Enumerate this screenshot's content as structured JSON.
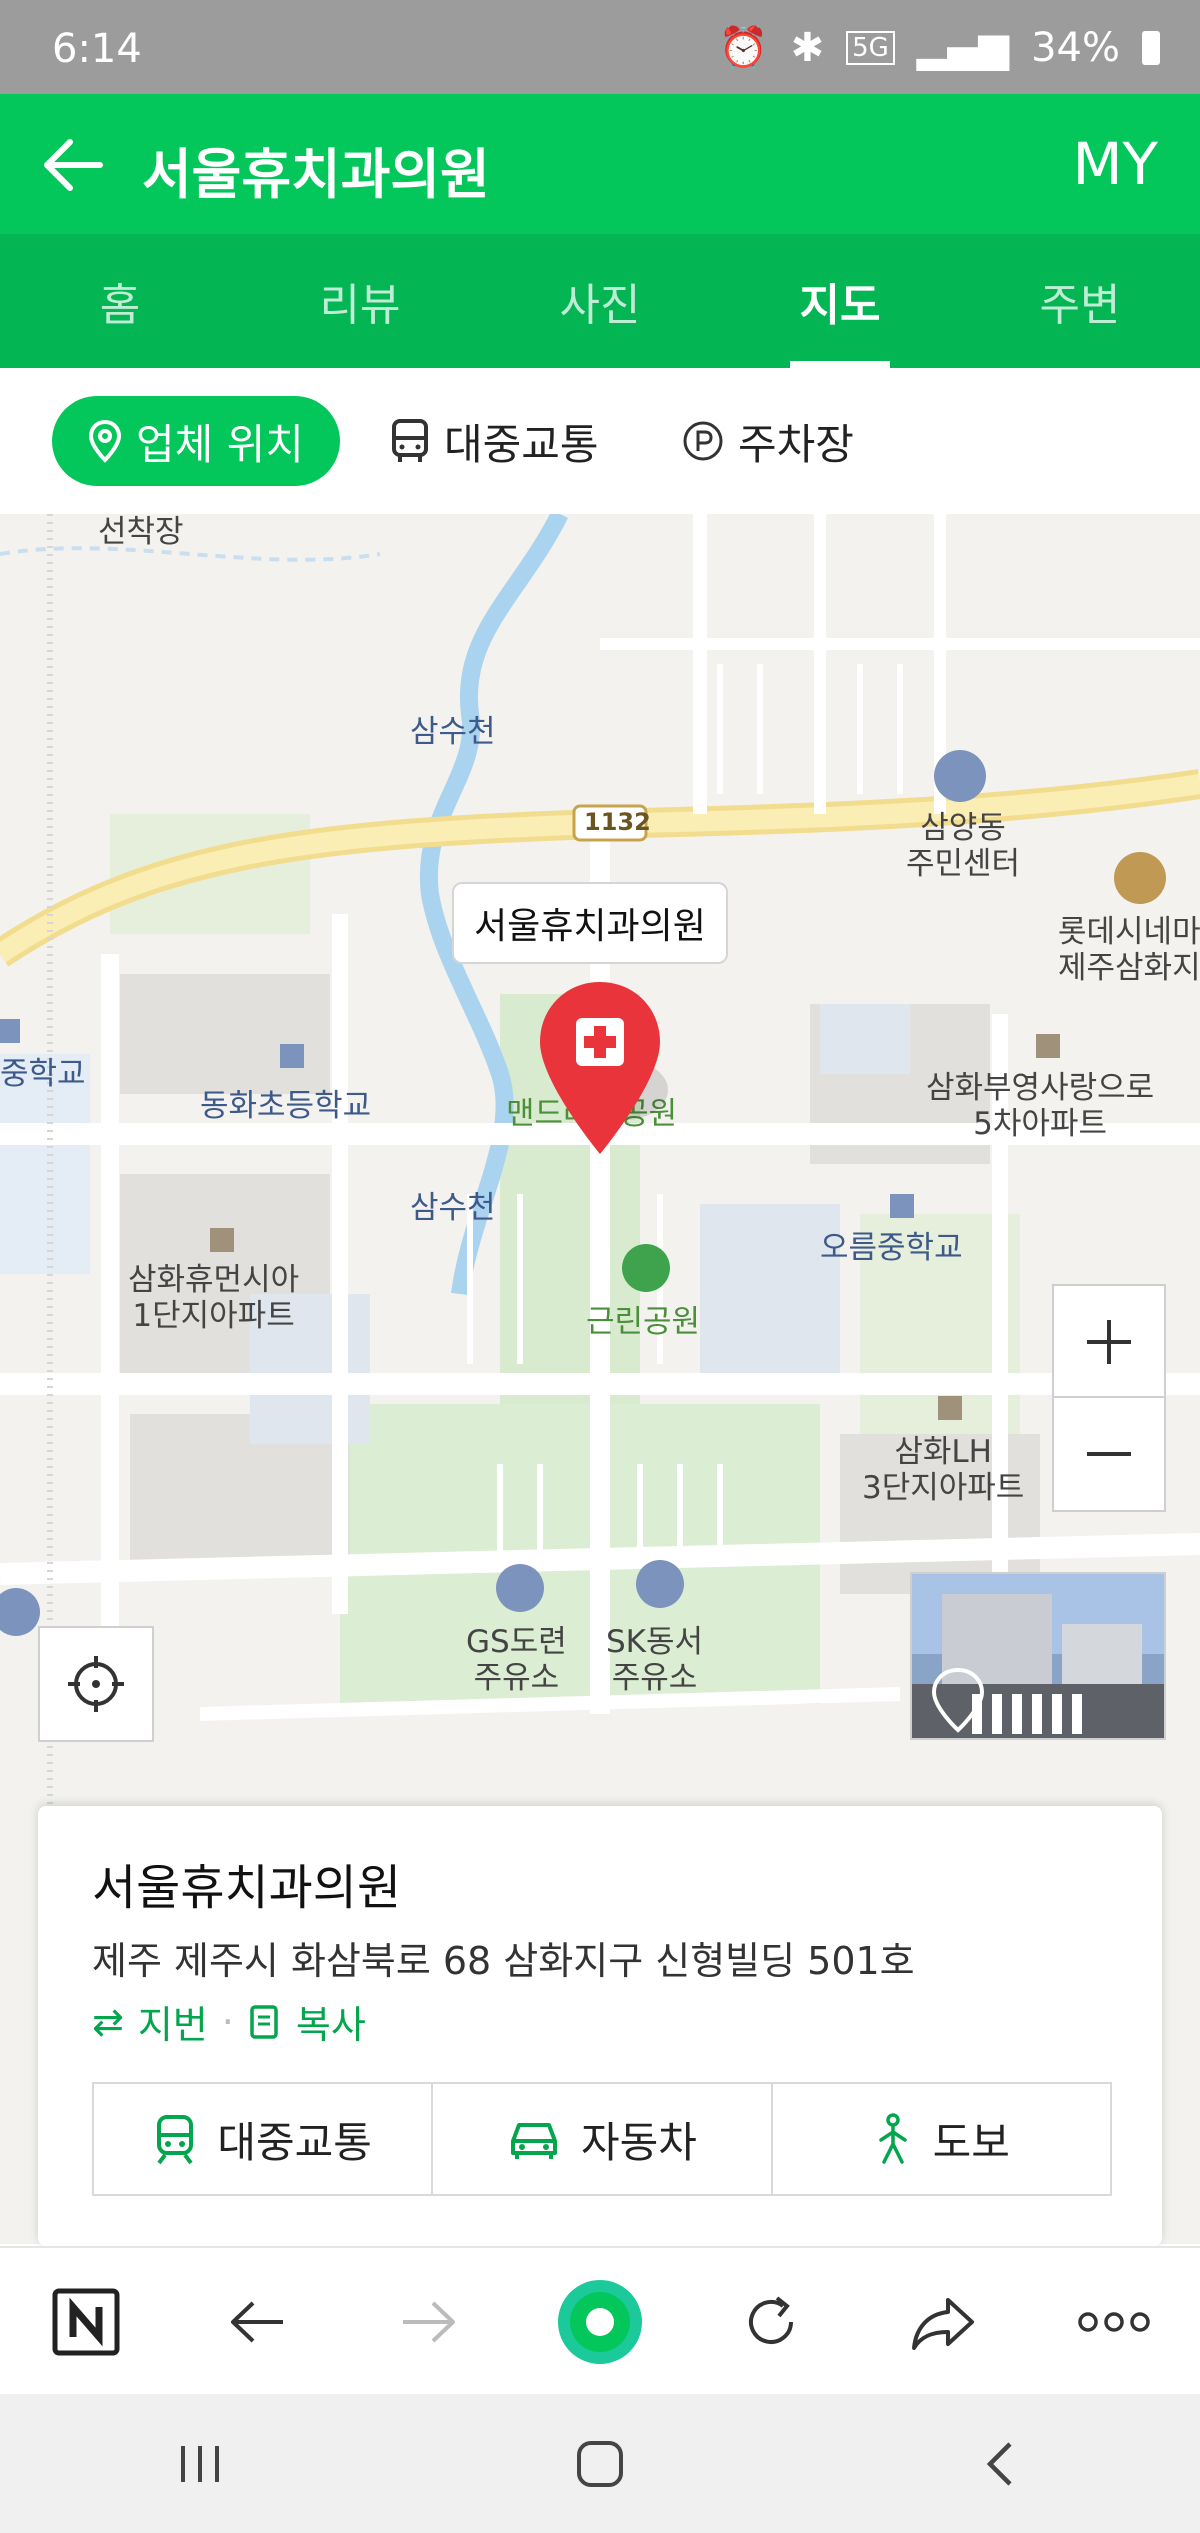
{
  "status_bar": {
    "time": "6:14",
    "network": "5G",
    "battery": "34%"
  },
  "header": {
    "title": "서울휴치과의원",
    "my_label": "MY"
  },
  "tabs": [
    {
      "label": "홈",
      "active": false
    },
    {
      "label": "리뷰",
      "active": false
    },
    {
      "label": "사진",
      "active": false
    },
    {
      "label": "지도",
      "active": true
    },
    {
      "label": "주변",
      "active": false
    }
  ],
  "filters": {
    "location": "업체 위치",
    "transit": "대중교통",
    "parking": "주차장"
  },
  "map": {
    "callout": "서울휴치과의원",
    "road_number": "1132",
    "labels": {
      "pier": "선착장",
      "stream1": "삼수천",
      "stream2": "삼수천",
      "community_center": "삼양동\n주민센터",
      "cinema": "롯데시네마\n제주삼화지",
      "middle_school_left": "중학교",
      "elementary": "동화초등학교",
      "park_mand": "맨드라미공원",
      "apt_samhwa5": "삼화부영사랑으로\n5차아파트",
      "oreum_school": "오름중학교",
      "apt_humansia": "삼화휴먼시아\n1단지아파트",
      "neighborhood_park": "근린공원",
      "apt_lh3": "삼화LH\n3단지아파트",
      "gs_station": "GS도련\n주유소",
      "sk_station": "SK동서\n주유소"
    }
  },
  "card": {
    "name": "서울휴치과의원",
    "address": "제주 제주시 화삼북로 68 삼화지구 신형빌딩 501호",
    "jibun_label": "지번",
    "copy_label": "복사",
    "transport": [
      "대중교통",
      "자동차",
      "도보"
    ]
  },
  "colors": {
    "brand": "#03c75a",
    "marker": "#e8343a"
  }
}
